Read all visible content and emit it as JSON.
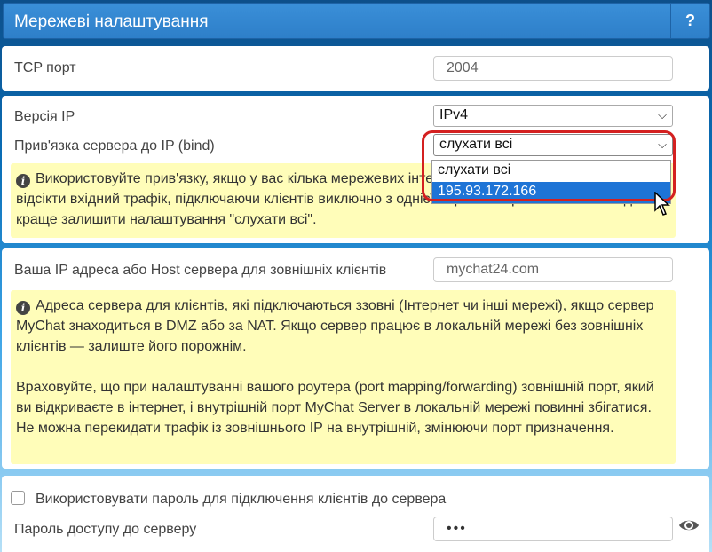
{
  "header": {
    "title": "Мережеві налаштування",
    "help": "?"
  },
  "tcp_port": {
    "label": "TCP порт",
    "value": "2004"
  },
  "ip_version": {
    "label": "Версія IP",
    "value": "IPv4"
  },
  "bind": {
    "label": "Прив'язка сервера до IP (bind)",
    "value": "слухати всі",
    "options": [
      "слухати всі",
      "195.93.172.166"
    ],
    "highlighted_index": 1,
    "note": "Використовуйте прив'язку, якщо у вас кілька мережевих інтерфейсів на сервері і ви хочете відсікти вхідний трафік, підключаючи клієнтів виключно з однієї обраної мережі. У 99% випадків краще залишити налаштування \"слухати всі\"."
  },
  "host": {
    "label": "Ваша IP адреса або Host сервера для зовнішніх клієнтів",
    "value": "mychat24.com",
    "note1": "Адреса сервера для клієнтів, які підключаються ззовні (Інтернет чи інші мережі), якщо сервер MyChat знаходиться в DMZ або за NAT. Якщо сервер працює в локальній мережі без зовнішніх клієнтів — залиште його порожнім.",
    "note2": "Враховуйте, що при налаштуванні вашого роутера (port mapping/forwarding) зовнішній порт, який ви відкриваєте в інтернет, і внутрішній порт MyChat Server в локальній мережі повинні збігатися. Не можна перекидати трафік із зовнішнього IP на внутрішній, змінюючи порт призначення."
  },
  "password": {
    "use_label": "Використовувати пароль для підключення клієнтів до сервера",
    "checked": false,
    "label": "Пароль доступу до серверу",
    "value": "•••"
  },
  "colors": {
    "accent": "#2e7fc9",
    "note_bg": "#fffdb9",
    "highlight": "#d42020",
    "selected": "#1e74d6"
  }
}
